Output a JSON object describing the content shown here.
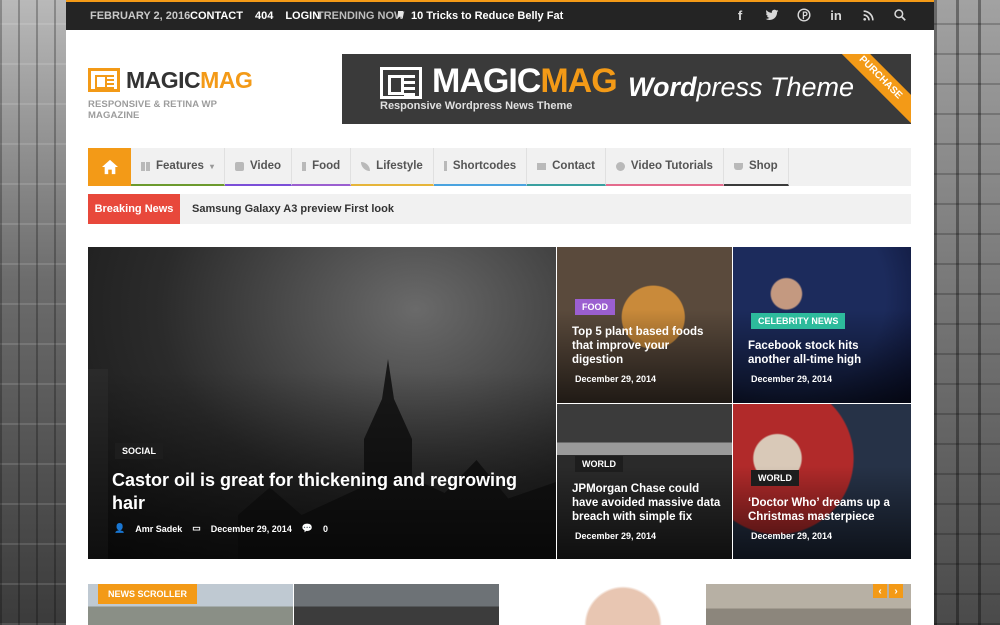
{
  "topbar": {
    "date": "FEBRUARY 2, 2016",
    "links": [
      "CONTACT",
      "404",
      "LOGIN"
    ],
    "trending_label": "TRENDING NOW",
    "trending_title": "10 Tricks to Reduce Belly Fat",
    "social": [
      {
        "name": "facebook-icon",
        "glyph": "f"
      },
      {
        "name": "twitter-icon",
        "glyph": "🐦"
      },
      {
        "name": "pinterest-icon",
        "glyph": "℗"
      },
      {
        "name": "linkedin-icon",
        "glyph": "in"
      },
      {
        "name": "rss-icon",
        "glyph": "◝"
      },
      {
        "name": "search-icon",
        "glyph": "⌕"
      }
    ]
  },
  "logo": {
    "name_part1": "MAGIC",
    "name_part2": "MAG",
    "tagline": "RESPONSIVE & RETINA WP MAGAZINE"
  },
  "banner": {
    "name_part1": "MAGIC",
    "name_part2": "MAG",
    "subtitle": "Responsive Wordpress News Theme",
    "theme_bold": "Word",
    "theme_rest": "press Theme",
    "ribbon": "PURCHASE"
  },
  "nav": {
    "items": [
      {
        "label": "Features",
        "color": "#6c9a2d",
        "caret": "▾"
      },
      {
        "label": "Video",
        "color": "#7b4fd8"
      },
      {
        "label": "Food",
        "color": "#9b5fd0"
      },
      {
        "label": "Lifestyle",
        "color": "#e6b53a"
      },
      {
        "label": "Shortcodes",
        "color": "#4aa3df"
      },
      {
        "label": "Contact",
        "color": "#3aa0a0"
      },
      {
        "label": "Video Tutorials",
        "color": "#e46b8d"
      },
      {
        "label": "Shop",
        "color": "#3b3b3b"
      }
    ]
  },
  "breaking": {
    "label": "Breaking News",
    "text": "Samsung Galaxy A3 preview First look"
  },
  "featured": {
    "main": {
      "category": "SOCIAL",
      "title": "Castor oil is great for thickening and regrowing hair",
      "author": "Amr Sadek",
      "date": "December 29, 2014",
      "comments": "0"
    },
    "tiles": [
      {
        "category": "FOOD",
        "category_color": "#9b5fd0",
        "title": "Top 5 plant based foods that improve your digestion",
        "date": "December 29, 2014"
      },
      {
        "category": "CELEBRITY NEWS",
        "category_color": "#2dbb9c",
        "title": "Facebook stock hits another all-time high",
        "date": "December 29, 2014"
      },
      {
        "category": "WORLD",
        "category_color": "#1d1d1d",
        "title": "JPMorgan Chase could have avoided massive data breach with simple fix",
        "date": "December 29, 2014"
      },
      {
        "category": "WORLD",
        "category_color": "#1d1d1d",
        "title": "‘Doctor Who’ dreams up a Christmas masterpiece",
        "date": "December 29, 2014"
      }
    ]
  },
  "scroller": {
    "label": "NEWS SCROLLER",
    "prev": "‹",
    "next": "›"
  },
  "brand_colors": {
    "accent": "#f39a17",
    "breaking": "#e8483b"
  }
}
